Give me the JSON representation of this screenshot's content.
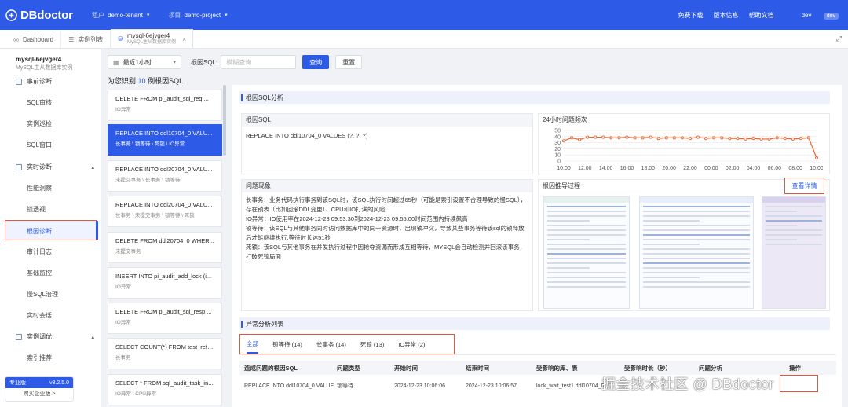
{
  "app": {
    "name": "DBdoctor"
  },
  "topbar": {
    "tenant_label": "租户",
    "tenant_value": "demo-tenant",
    "project_label": "项目",
    "project_value": "demo-project",
    "links": [
      "免费下载",
      "版本信息",
      "帮助文档"
    ],
    "user": "dev",
    "user_badge": "dev"
  },
  "tabs": [
    {
      "label": "Dashboard"
    },
    {
      "label": "实例列表"
    },
    {
      "label": "mysql-6ejvger4",
      "sub": "MySQL主从数据库实例",
      "active": true
    }
  ],
  "sidebar": {
    "db_name": "mysql-6ejvger4",
    "db_sub": "MySQL主从数据库实例",
    "groups": [
      {
        "label": "事前诊断",
        "items": [
          "SQL审核",
          "实例巡检",
          "SQL窗口"
        ]
      },
      {
        "label": "实时诊断",
        "items": [
          "性能洞察",
          "锁透视",
          "根因诊断",
          "审计日志",
          "基础监控",
          "慢SQL治理",
          "实时会话"
        ]
      },
      {
        "label": "实例调优",
        "items": [
          "索引推荐"
        ]
      }
    ],
    "active_item": "根因诊断",
    "edition": {
      "label": "专业版",
      "version": "v3.2.5.0",
      "buy": "购买企业版 >"
    }
  },
  "filter": {
    "time_range": "最近1小时",
    "root_sql_label": "根因SQL:",
    "root_sql_placeholder": "模糊查询",
    "search_btn": "查询",
    "reset_btn": "重置"
  },
  "summary": {
    "prefix": "为您识别",
    "count": "10",
    "suffix": "例根因SQL"
  },
  "sql_list": [
    {
      "sql": "DELETE FROM pi_audit_sql_req ...",
      "tags": "IO异常"
    },
    {
      "sql": "REPLACE INTO ddl10704_0 VALU...",
      "tags": "长事务 \\ 锁等待 \\ 死锁 \\ IO异常",
      "selected": true
    },
    {
      "sql": "REPLACE INTO ddl30704_0 VALU...",
      "tags": "未提交事务 \\ 长事务 \\ 锁等待"
    },
    {
      "sql": "REPLACE INTO ddl20704_0 VALU...",
      "tags": "长事务 \\ 未提交事务 \\ 锁等待 \\ 死锁"
    },
    {
      "sql": "DELETE FROM ddl20704_0 WHER...",
      "tags": "未提交事务"
    },
    {
      "sql": "INSERT INTO pi_audit_add_lock (i...",
      "tags": "IO异常"
    },
    {
      "sql": "DELETE FROM pi_audit_sql_resp ...",
      "tags": "IO异常"
    },
    {
      "sql": "SELECT COUNT(*) FROM test_ref_...",
      "tags": "长事务"
    },
    {
      "sql": "SELECT * FROM sql_audit_task_in...",
      "tags": "IO异常 \\ CPU异常"
    }
  ],
  "analysis": {
    "section_title": "根因SQL分析",
    "root_sql_title": "根因SQL",
    "root_sql_text": "REPLACE INTO ddl10704_0 VALUES (?, ?, ?)",
    "freq_title": "24小时问题频次",
    "problem_title": "问题现象",
    "problem_lines": [
      "长事务：业务代码执行事务到该SQL时，该SQL执行时间超过65秒（可能是索引设置不合理导致的慢SQL），存在锁表（比如回滚DDL变更）、CPU和IO打满的风险",
      "IO异常：IO使用率在2024-12-23 09:53:30到2024-12-23 09:55:00时间范围内持续飙高",
      "锁等待：该SQL与其他事务同时访问数据库中的同一资源时，出现锁冲突，导致某些事务等待该sql的锁释放后才能继续执行,等待时长达51秒",
      "死锁：该SQL与其他事务在并发执行过程中因抢夺资源而形成互相等待，MYSQL会自动检测并回滚该事务，打破死锁局面"
    ],
    "reasoning_title": "根因推导过程",
    "view_detail": "查看详情"
  },
  "anomaly": {
    "section_title": "异常分析列表",
    "tabs": [
      "全部",
      "锁等待 (14)",
      "长事务 (14)",
      "死锁 (13)",
      "IO异常 (2)"
    ],
    "columns": [
      "造成问题的根因SQL",
      "问题类型",
      "开始时间",
      "结束时间",
      "受影响的库、表",
      "受影响时长（秒）",
      "问题分析",
      "操作"
    ],
    "rows": [
      [
        "REPLACE INTO ddl10704_0 VALUE",
        "锁等待",
        "2024-12-23 10:06:06",
        "2024-12-23 10:06:57",
        "lock_wait_test1.ddl10704_0",
        "",
        "",
        ""
      ]
    ]
  },
  "watermark": "掘金技术社区 @ DBdoctor",
  "chart_data": {
    "type": "line",
    "title": "24小时问题频次",
    "x": [
      "10:00",
      "10:45",
      "11:30",
      "12:15",
      "13:00",
      "13:45",
      "14:30",
      "15:15",
      "16:00",
      "16:45",
      "17:30",
      "18:15",
      "19:00",
      "19:45",
      "20:30",
      "21:15",
      "22:00",
      "22:45",
      "23:30",
      "00:15",
      "01:00",
      "01:45",
      "02:30",
      "03:15",
      "04:00",
      "04:45",
      "05:30",
      "06:15",
      "07:00",
      "07:45",
      "08:30",
      "09:15",
      "10:00"
    ],
    "series": [
      {
        "values": [
          33,
          38,
          35,
          39,
          39,
          39,
          38,
          38,
          39,
          38,
          38,
          39,
          37,
          38,
          38,
          38,
          37,
          39,
          37,
          38,
          38,
          37,
          37,
          36,
          37,
          36,
          36,
          38,
          37,
          36,
          37,
          38,
          5
        ]
      }
    ],
    "xticks": [
      "10:00",
      "12:00",
      "14:00",
      "16:00",
      "18:00",
      "20:00",
      "22:00",
      "00:00",
      "02:00",
      "04:00",
      "06:00",
      "08:00",
      "10:00"
    ],
    "yticks": [
      0,
      10,
      20,
      30,
      40,
      50
    ],
    "ylim": [
      0,
      50
    ],
    "color": "#e8652f",
    "grid": true
  }
}
